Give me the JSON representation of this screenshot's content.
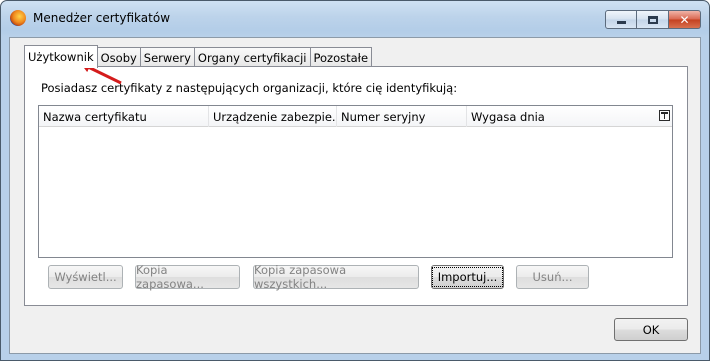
{
  "window": {
    "title": "Menedżer certyfikatów",
    "icon": "firefox-icon",
    "controls": {
      "minimize": "minimize-icon",
      "maximize": "maximize-icon",
      "close": "✕"
    }
  },
  "tabs": [
    {
      "label": "Użytkownik",
      "active": true
    },
    {
      "label": "Osoby",
      "active": false
    },
    {
      "label": "Serwery",
      "active": false
    },
    {
      "label": "Organy certyfikacji",
      "active": false
    },
    {
      "label": "Pozostałe",
      "active": false
    }
  ],
  "panel": {
    "intro": "Posiadasz certyfikaty z następujących organizacji, które cię identyfikują:",
    "columns": [
      "Nazwa certyfikatu",
      "Urządzenie zabezpie...",
      "Numer seryjny",
      "Wygasa dnia"
    ],
    "column_picker_icon": "column-picker-icon",
    "rows": [],
    "buttons": {
      "view": "Wyświetl...",
      "backup": "Kopia zapasowa...",
      "backup_all": "Kopia zapasowa wszystkich...",
      "import": "Importuj...",
      "delete": "Usuń..."
    }
  },
  "footer": {
    "ok": "OK"
  },
  "annotation": {
    "color": "#d41c1c"
  }
}
